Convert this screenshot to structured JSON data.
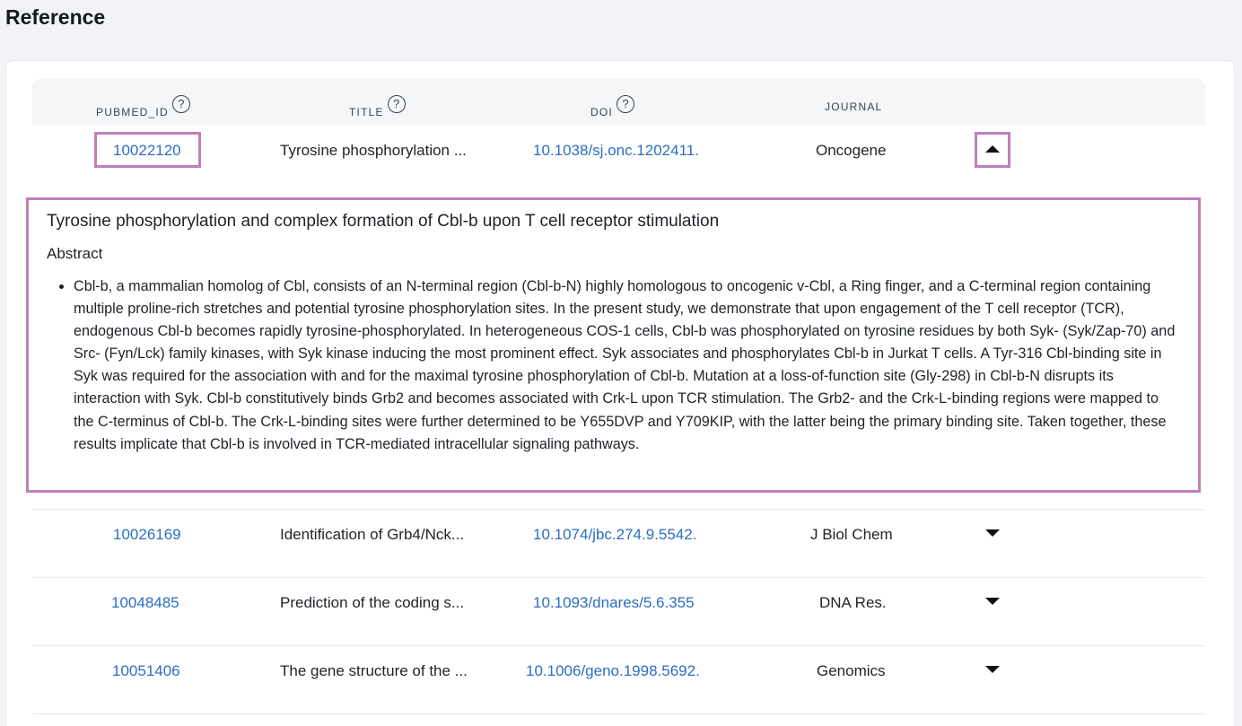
{
  "page": {
    "title": "Reference"
  },
  "table": {
    "columns": [
      {
        "label": "PUBMED_ID",
        "help": "?"
      },
      {
        "label": "TITLE",
        "help": "?"
      },
      {
        "label": "DOI",
        "help": "?"
      },
      {
        "label": "JOURNAL"
      }
    ],
    "rows": [
      {
        "pubmed_id": "10022120",
        "title": "Tyrosine phosphorylation ...",
        "doi": "10.1038/sj.onc.1202411.",
        "journal": "Oncogene",
        "expanded": true
      },
      {
        "pubmed_id": "10026169",
        "title": "Identification of Grb4/Nck...",
        "doi": "10.1074/jbc.274.9.5542.",
        "journal": "J Biol Chem",
        "expanded": false
      },
      {
        "pubmed_id": "10048485",
        "title": "Prediction of the coding s...",
        "doi": "10.1093/dnares/5.6.355",
        "journal": "DNA Res.",
        "expanded": false
      },
      {
        "pubmed_id": "10051406",
        "title": "The gene structure of the ...",
        "doi": "10.1006/geno.1998.5692.",
        "journal": "Genomics",
        "expanded": false
      }
    ]
  },
  "detail": {
    "title": "Tyrosine phosphorylation and complex formation of Cbl-b upon T cell receptor stimulation",
    "abstract_label": "Abstract",
    "abstract": "Cbl-b, a mammalian homolog of Cbl, consists of an N-terminal region (Cbl-b-N) highly homologous to oncogenic v-Cbl, a Ring finger, and a C-terminal region containing multiple proline-rich stretches and potential tyrosine phosphorylation sites. In the present study, we demonstrate that upon engagement of the T cell receptor (TCR), endogenous Cbl-b becomes rapidly tyrosine-phosphorylated. In heterogeneous COS-1 cells, Cbl-b was phosphorylated on tyrosine residues by both Syk- (Syk/Zap-70) and Src- (Fyn/Lck) family kinases, with Syk kinase inducing the most prominent effect. Syk associates and phosphorylates Cbl-b in Jurkat T cells. A Tyr-316 Cbl-binding site in Syk was required for the association with and for the maximal tyrosine phosphorylation of Cbl-b. Mutation at a loss-of-function site (Gly-298) in Cbl-b-N disrupts its interaction with Syk. Cbl-b constitutively binds Grb2 and becomes associated with Crk-L upon TCR stimulation. The Grb2- and the Crk-L-binding regions were mapped to the C-terminus of Cbl-b. The Crk-L-binding sites were further determined to be Y655DVP and Y709KIP, with the latter being the primary binding site. Taken together, these results implicate that Cbl-b is involved in TCR-mediated intracellular signaling pathways."
  },
  "colors": {
    "link": "#2c6ec0",
    "highlight": "#c07fbb",
    "header_bg": "#f4f6f8"
  },
  "icons": {
    "help": "question-circle-icon",
    "collapse": "caret-up-icon",
    "expand": "caret-down-icon"
  }
}
